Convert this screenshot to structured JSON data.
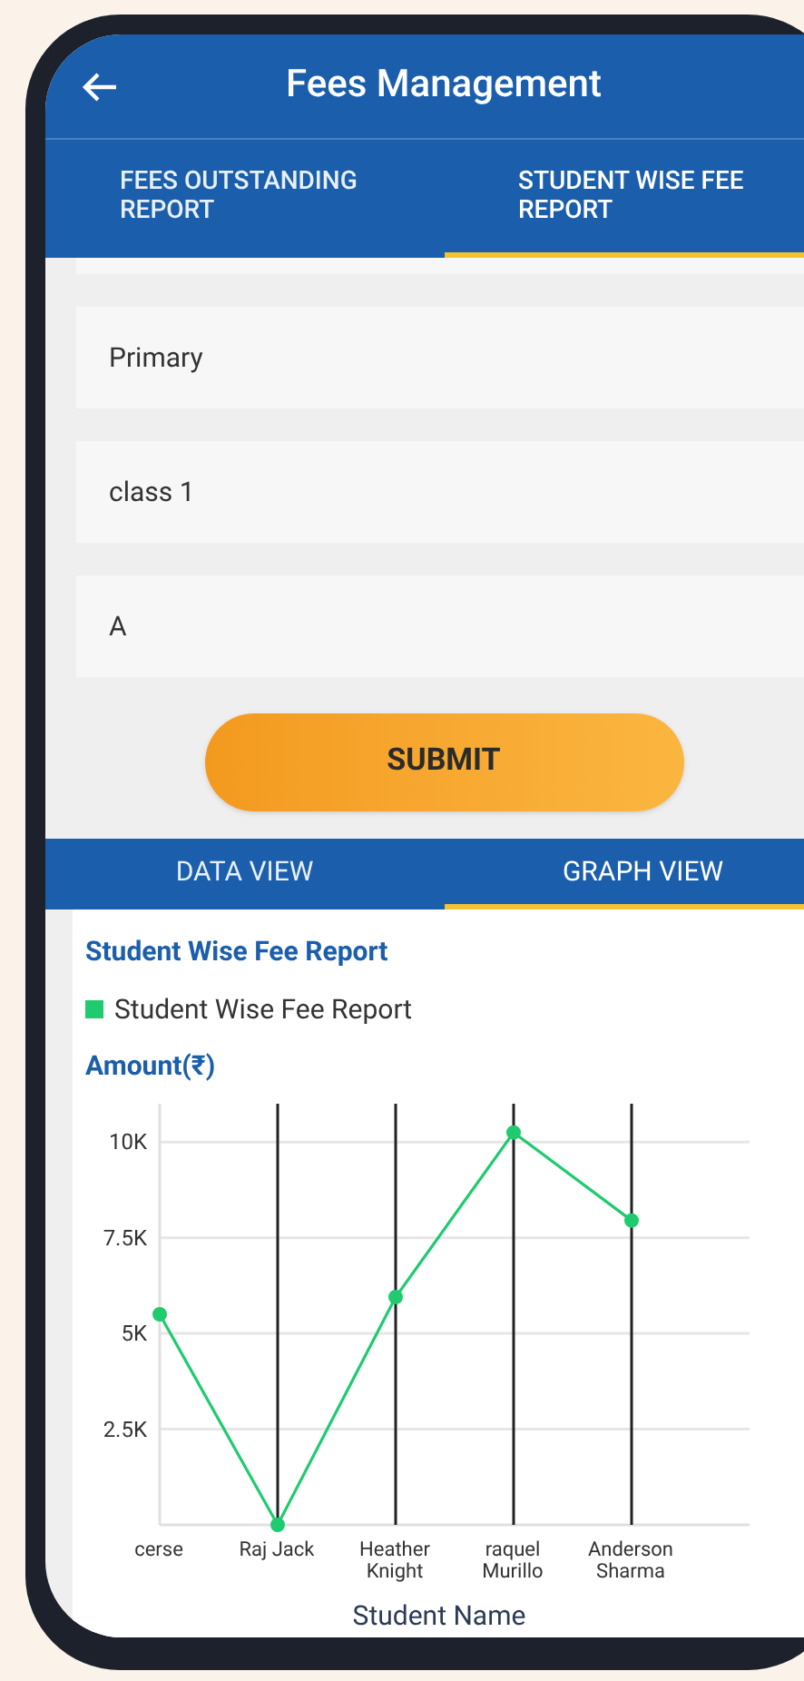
{
  "app_bar": {
    "title": "Fees Management"
  },
  "tabs": [
    {
      "label": "FEES OUTSTANDING REPORT",
      "selected": false
    },
    {
      "label": "STUDENT WISE FEE REPORT",
      "selected": true
    }
  ],
  "fields": [
    {
      "value": "Primary"
    },
    {
      "value": "class 1"
    },
    {
      "value": "A"
    }
  ],
  "submit_button": "SUBMIT",
  "view_tabs": [
    {
      "label": "DATA VIEW",
      "selected": false
    },
    {
      "label": "GRAPH VIEW",
      "selected": true
    }
  ],
  "report": {
    "title": "Student Wise Fee Report",
    "chart_data": {
      "type": "line",
      "ylabel": "Amount(₹)",
      "xlabel": "Student Name",
      "categories": [
        "cerse",
        "Raj Jack",
        "Heather Knight",
        "raquel Murillo",
        "Anderson Sharma"
      ],
      "series": [
        {
          "name": "Student Wise Fee Report",
          "color": "#1ecb6e",
          "marker": "circle",
          "values": [
            5500,
            0,
            5950,
            10250,
            7950
          ]
        }
      ],
      "grid": true,
      "ylim": [
        0,
        11000
      ],
      "yticks": [
        {
          "value": 2500,
          "label": "2.5K"
        },
        {
          "value": 5000,
          "label": "5K"
        },
        {
          "value": 7500,
          "label": "7.5K"
        },
        {
          "value": 10000,
          "label": "10K"
        }
      ]
    }
  }
}
